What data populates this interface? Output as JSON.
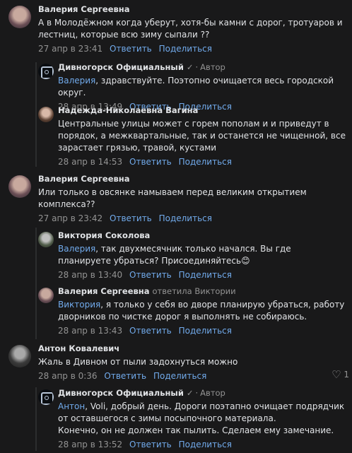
{
  "actions": {
    "reply": "Ответить",
    "share": "Поделиться"
  },
  "comments": [
    {
      "author": "Валерия Сергеевна",
      "text": "А в Молодёжном когда уберут, хотя-бы камни с дорог, тротуаров и лестниц, которые всю зиму сыпали ??",
      "time": "27 апр в 23:41"
    },
    {
      "author": "Дивногорск Официальный",
      "badge": "✓",
      "role": "Автор",
      "mention": "Валерия",
      "text": ", здравствуйте. Поэтопно очищается весь городской округ.",
      "time": "28 апр в 13:49"
    },
    {
      "author": "Надежда-Николаевна Вагина",
      "text": "Центральные улицы может с горем пополам и и приведут в порядок, а межквартальные, так и останется не чищенной, все зарастает грязью, травой, кустами",
      "time": "28 апр в 14:53"
    },
    {
      "author": "Валерия Сергеевна",
      "text": "Или только в овсянке намываем перед великим открытием комплекса??",
      "time": "27 апр в 23:42"
    },
    {
      "author": "Виктория Соколова",
      "mention": "Валерия",
      "text": ", так двухмесячник только начался. Вы где планируете убраться? Присоединяйтесь😊",
      "time": "28 апр в 13:40"
    },
    {
      "author": "Валерия Сергеевна",
      "replied_to": "ответила Виктории",
      "mention": "Виктория",
      "text": ", я только у себя во дворе планирую убраться, работу дворников по чистке дорог я выполнять не собираюсь.",
      "time": "28 апр в 13:43"
    },
    {
      "author": "Антон Ковалевич",
      "text": "Жаль в Дивном от пыли задохнуться можно",
      "time": "28 апр в 0:36",
      "likes": "1"
    },
    {
      "author": "Дивногорск Официальный",
      "badge": "✓",
      "role": "Автор",
      "mention": "Антон",
      "text": ", Voli, добрый день. Дороги поэтапно очищает подрядчик от оставшегося с зимы посыпочного материала.",
      "text2": "Конечно, он не должен так пылить. Сделаем ему замечание.",
      "time": "28 апр в 13:52"
    }
  ],
  "colors": {
    "background": "#19191a",
    "link": "#71aaeb",
    "secondary": "#939393",
    "text": "#e1e3e6"
  }
}
